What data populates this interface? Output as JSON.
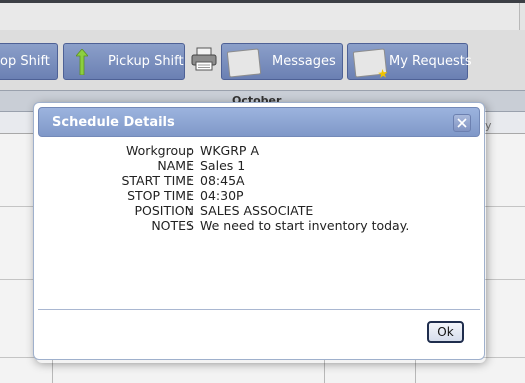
{
  "toolbar": {
    "drop_shift_label": "op Shift",
    "pickup_shift_label": "Pickup Shift",
    "messages_label": "Messages",
    "my_requests_label": "My Requests"
  },
  "calendar": {
    "month": "October",
    "ghost_text": "y"
  },
  "dialog": {
    "title": "Schedule Details",
    "fields": [
      {
        "label": "Workgroup",
        "value": "WKGRP A"
      },
      {
        "label": "NAME",
        "value": "Sales 1"
      },
      {
        "label": "START TIME",
        "value": "08:45A"
      },
      {
        "label": "STOP TIME",
        "value": "04:30P"
      },
      {
        "label": "POSITION",
        "value": "SALES ASSOCIATE"
      },
      {
        "label": "NOTES",
        "value": "We need to start inventory today."
      }
    ],
    "separator": ":",
    "ok_label": "Ok"
  },
  "icons": {
    "pickup": "up-arrow-icon",
    "print": "printer-icon",
    "messages": "document-icon",
    "requests": "document-star-icon",
    "close": "close-icon"
  },
  "colors": {
    "button_blue": "#7b8fc0",
    "title_blue": "#8ea6d4",
    "arrow_green": "#8ccf3f"
  }
}
